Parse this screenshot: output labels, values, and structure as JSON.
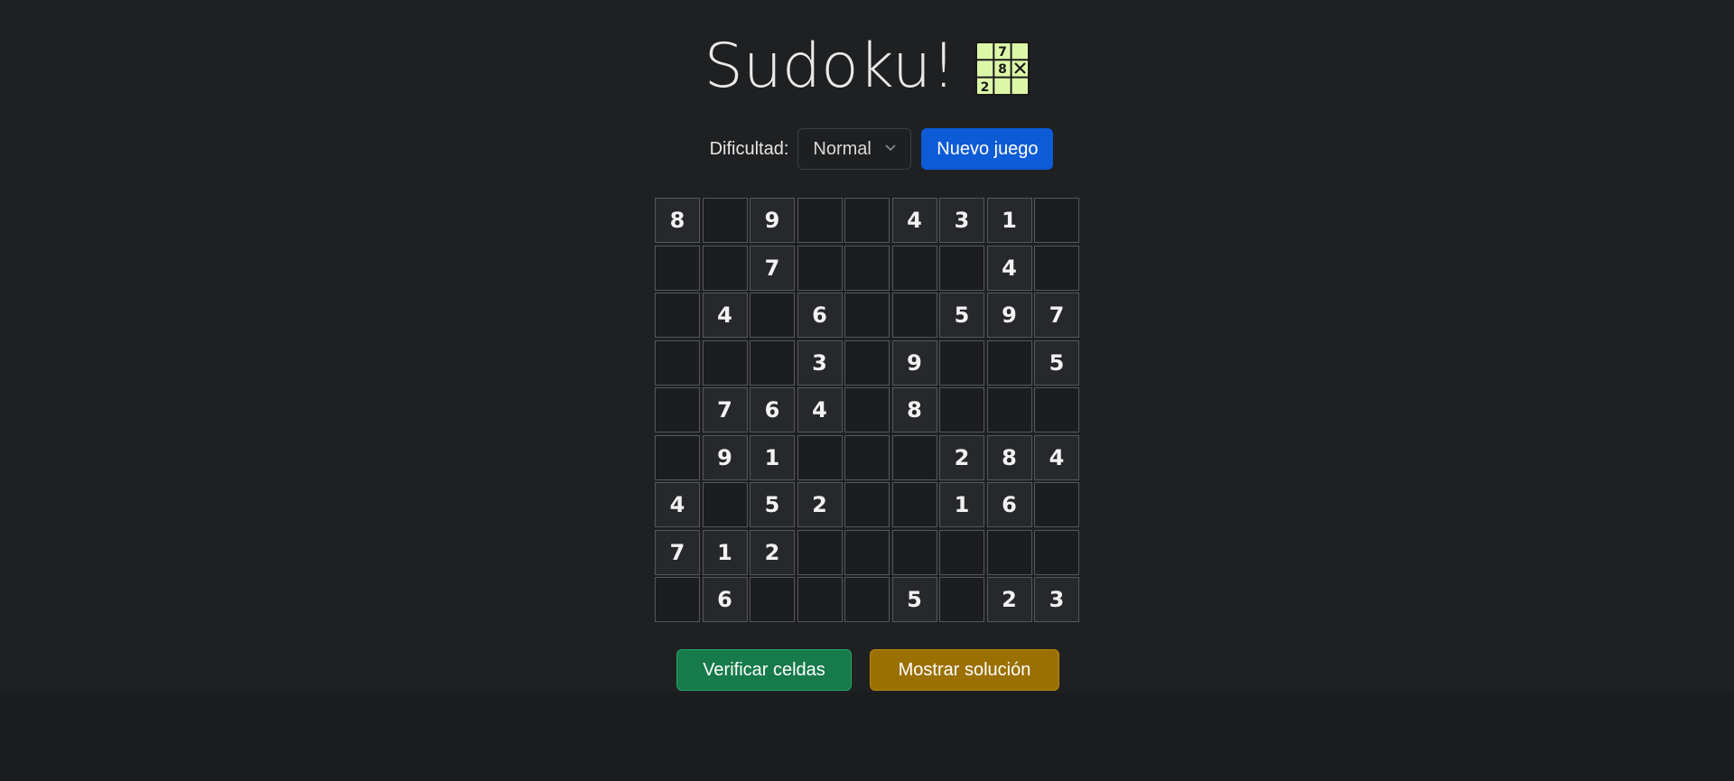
{
  "header": {
    "title": "Sudoku!",
    "logo_icon": "sudoku-grid-icon",
    "logo_digits": [
      "7",
      "8",
      "2"
    ]
  },
  "controls": {
    "difficulty_label": "Dificultad:",
    "difficulty_selected": "Normal",
    "new_game_label": "Nuevo juego"
  },
  "board": {
    "rows": [
      [
        "8",
        "",
        "9",
        "",
        "",
        "4",
        "3",
        "1",
        ""
      ],
      [
        "",
        "",
        "7",
        "",
        "",
        "",
        "",
        "4",
        ""
      ],
      [
        "",
        "4",
        "",
        "6",
        "",
        "",
        "5",
        "9",
        "7"
      ],
      [
        "",
        "",
        "",
        "3",
        "",
        "9",
        "",
        "",
        "5"
      ],
      [
        "",
        "7",
        "6",
        "4",
        "",
        "8",
        "",
        "",
        ""
      ],
      [
        "",
        "9",
        "1",
        "",
        "",
        "",
        "2",
        "8",
        "4"
      ],
      [
        "4",
        "",
        "5",
        "2",
        "",
        "",
        "1",
        "6",
        ""
      ],
      [
        "7",
        "1",
        "2",
        "",
        "",
        "",
        "",
        "",
        ""
      ],
      [
        "",
        "6",
        "",
        "",
        "",
        "5",
        "",
        "2",
        "3"
      ]
    ]
  },
  "actions": {
    "verify_label": "Verificar celdas",
    "show_solution_label": "Mostrar solución"
  },
  "colors": {
    "primary": "#0d5bd6",
    "success": "#177a4b",
    "warning": "#9b7003",
    "background": "#1f2022",
    "logo_fill": "#ddf7a8"
  }
}
